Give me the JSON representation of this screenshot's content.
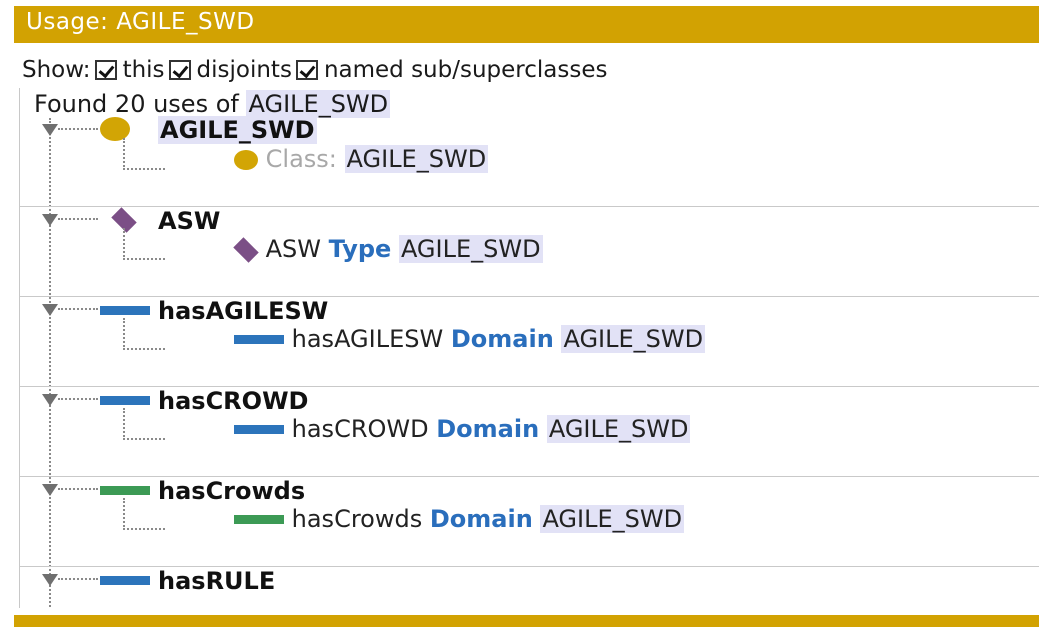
{
  "window": {
    "title": "Usage: AGILE_SWD"
  },
  "show": {
    "label": "Show:",
    "options": [
      {
        "label": "this",
        "checked": true
      },
      {
        "label": "disjoints",
        "checked": true
      },
      {
        "label": "named sub/superclasses",
        "checked": true
      }
    ]
  },
  "found": {
    "prefix": "Found 20 uses of",
    "entity": "AGILE_SWD"
  },
  "groups": [
    {
      "title": "AGILE_SWD",
      "icon": "class-circle-icon",
      "line": {
        "prefix": "Class:",
        "subject": "",
        "keyword": "",
        "object": "AGILE_SWD"
      }
    },
    {
      "title": "ASW",
      "icon": "individual-diamond-icon",
      "line": {
        "subject": "ASW",
        "keyword": "Type",
        "object": "AGILE_SWD"
      }
    },
    {
      "title": "hasAGILESW",
      "icon": "object-property-icon",
      "line": {
        "subject": "hasAGILESW",
        "keyword": "Domain",
        "object": "AGILE_SWD"
      }
    },
    {
      "title": "hasCROWD",
      "icon": "object-property-icon",
      "line": {
        "subject": "hasCROWD",
        "keyword": "Domain",
        "object": "AGILE_SWD"
      }
    },
    {
      "title": "hasCrowds",
      "icon": "data-property-icon",
      "line": {
        "subject": "hasCrowds",
        "keyword": "Domain",
        "object": "AGILE_SWD"
      }
    },
    {
      "title": "hasRULE",
      "icon": "object-property-icon"
    }
  ],
  "colors": {
    "accent": "#d2a202",
    "class": "#d2a505",
    "individual": "#7b4f86",
    "object_property": "#2c74bb",
    "data_property": "#3c9a55",
    "keyword": "#2a6ebc",
    "highlight": "#e2e2f6"
  }
}
